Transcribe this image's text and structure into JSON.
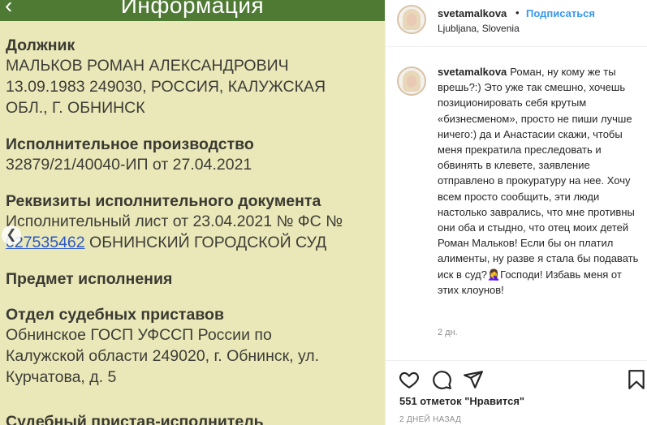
{
  "document": {
    "header_title": "Информация",
    "icons": {
      "back": "back-chevron-icon",
      "gallery_prev": "chevron-left-icon"
    },
    "sections": [
      {
        "label": "Должник",
        "lines": [
          "МАЛЬКОВ РОМАН АЛЕКСАНДРОВИЧ",
          "13.09.1983 249030, РОССИЯ, КАЛУЖСКАЯ",
          "ОБЛ., Г. ОБНИНСК"
        ]
      },
      {
        "label": "Исполнительное производство",
        "lines": [
          "32879/21/40040-ИП от 27.04.2021"
        ]
      },
      {
        "label": "Реквизиты исполнительного документа",
        "lines": [
          "Исполнительный лист от 23.04.2021 № ФС №"
        ],
        "link_number": "027535462",
        "link_tail": " ОБНИНСКИЙ ГОРОДСКОЙ СУД"
      },
      {
        "label": "Предмет исполнения",
        "lines": []
      },
      {
        "label": "Отдел судебных приставов",
        "lines": [
          "Обнинское ГОСП УФССП России по",
          "Калужской области 249020, г. Обнинск, ул.",
          "Курчатова, д. 5"
        ]
      }
    ],
    "cut_off_text": "Судебный пристав-исполнитель"
  },
  "post": {
    "username": "svetamalkova",
    "separator": "•",
    "follow_label": "Подписаться",
    "location": "Ljubljana, Slovenia",
    "comment": {
      "username": "svetamalkova",
      "text": "Роман, ну кому же ты врешь?:) Это уже так смешно, хочешь позиционировать себя крутым «бизнесменом», просто не пиши лучше ничего:) да и Анастасии скажи, чтобы меня прекратила преследовать и обвинять в клевете, заявление отправлено в прокуратуру на нее. Хочу всем просто сообщить, эти люди настолько заврались, что мне противны они оба и стыдно, что отец моих детей Роман Мальков! Если бы он платил алименты, ну разве я стала бы подавать иск в суд?🤦‍♀️Господи! Избавь меня от этих клоунов!",
      "age": "2 дн."
    },
    "actions": {
      "like": "heart-icon",
      "comment": "comment-bubble-icon",
      "share": "paper-plane-icon",
      "save": "bookmark-icon"
    },
    "likes_text": "551 отметок \"Нравится\"",
    "time_ago": "2 ДНЕЙ НАЗАД"
  },
  "colors": {
    "header_green": "#4f7a34",
    "doc_bg": "#eae8b8",
    "link_blue": "#2a57c8",
    "follow_blue": "#3897f0"
  }
}
